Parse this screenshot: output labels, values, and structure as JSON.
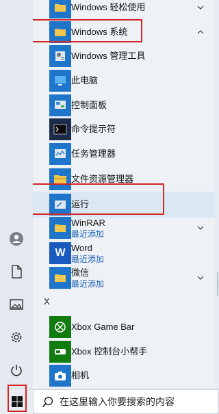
{
  "start_menu": {
    "items": [
      {
        "label": "Windows 轻松使用",
        "icon": "folder-icon",
        "chevron": "chevron-down"
      },
      {
        "label": "Windows 系统",
        "icon": "folder-icon",
        "chevron": "chevron-up"
      },
      {
        "label": "Windows 管理工具",
        "icon": "admin-tools-icon"
      },
      {
        "label": "此电脑",
        "icon": "computer-icon"
      },
      {
        "label": "控制面板",
        "icon": "control-panel-icon"
      },
      {
        "label": "命令提示符",
        "icon": "cmd-icon"
      },
      {
        "label": "任务管理器",
        "icon": "task-manager-icon"
      },
      {
        "label": "文件资源管理器",
        "icon": "explorer-icon"
      },
      {
        "label": "运行",
        "icon": "run-icon"
      },
      {
        "label": "WinRAR",
        "sub": "最近添加",
        "icon": "folder-icon",
        "chevron": "chevron-down"
      },
      {
        "label": "Word",
        "sub": "最近添加",
        "icon": "word-icon"
      },
      {
        "label": "微信",
        "sub": "最近添加",
        "icon": "folder-icon",
        "chevron": "chevron-down"
      },
      {
        "label": "Xbox Game Bar",
        "icon": "xbox-icon"
      },
      {
        "label": "Xbox 控制台小帮手",
        "icon": "xbox-console-icon"
      },
      {
        "label": "相机",
        "icon": "camera-icon"
      }
    ],
    "letter_x": "X",
    "word_tile": "W"
  },
  "rail": {
    "items": [
      "user-icon",
      "document-icon",
      "picture-icon",
      "settings-icon",
      "power-icon"
    ]
  },
  "taskbar": {
    "search_placeholder": "在这里输入你要搜索的内容",
    "start_icon": "windows-logo-icon",
    "search_icon": "search-icon"
  },
  "colors": {
    "accent": "#1f75c9",
    "highlight": "#d42525"
  }
}
